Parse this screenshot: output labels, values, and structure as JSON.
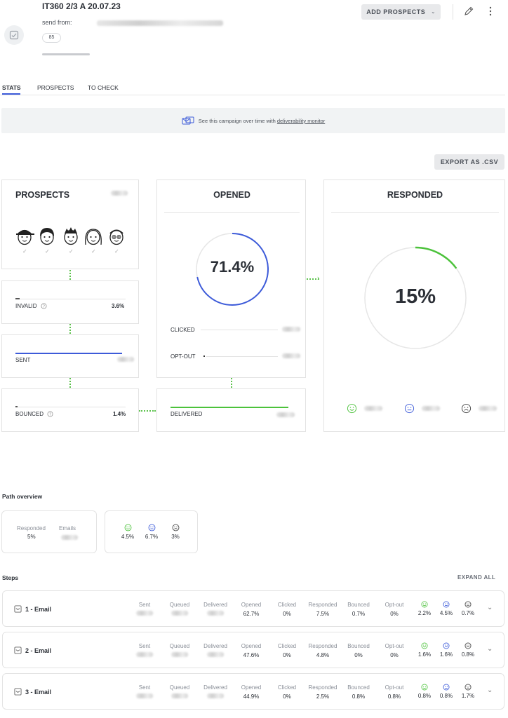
{
  "campaign": {
    "title": "IT360 2/3 A 20.07.23",
    "send_from_label": "send from:",
    "badge": "85"
  },
  "toolbar": {
    "add_prospects": "ADD PROSPECTS"
  },
  "tabs": [
    {
      "label": "STATS",
      "active": true
    },
    {
      "label": "PROSPECTS"
    },
    {
      "label": "TO CHECK"
    }
  ],
  "banner": {
    "text": "See this campaign over time with ",
    "link": "deliverability monitor"
  },
  "export_label": "EXPORT AS .CSV",
  "funnel": {
    "prospects_title": "PROSPECTS",
    "invalid": {
      "label": "INVALID",
      "value": "3.6%"
    },
    "sent": {
      "label": "SENT"
    },
    "bounced": {
      "label": "BOUNCED",
      "value": "1.4%"
    },
    "opened": {
      "title": "OPENED",
      "value": "71.4%",
      "percent": 71.4
    },
    "clicked_label": "CLICKED",
    "optout_label": "OPT-OUT",
    "delivered_label": "DELIVERED",
    "responded": {
      "title": "RESPONDED",
      "value": "15%",
      "percent": 15
    }
  },
  "colors": {
    "accent_blue": "#3d5bd9",
    "accent_green": "#4cc23b",
    "border": "#e3e3e3"
  },
  "path_overview": {
    "title": "Path overview",
    "responded_label": "Responded",
    "responded_value": "5%",
    "emails_label": "Emails",
    "positive": "4.5%",
    "neutral": "6.7%",
    "negative": "3%"
  },
  "steps_title": "Steps",
  "expand_all": "EXPAND ALL",
  "step_headers": [
    "Sent",
    "Queued",
    "Delivered",
    "Opened",
    "Clicked",
    "Responded",
    "Bounced",
    "Opt-out"
  ],
  "steps": [
    {
      "name": "1 - Email",
      "opened": "62.7%",
      "clicked": "0%",
      "responded": "7.5%",
      "bounced": "0.7%",
      "optout": "0%",
      "positive": "2.2%",
      "neutral": "4.5%",
      "negative": "0.7%"
    },
    {
      "name": "2 - Email",
      "opened": "47.6%",
      "clicked": "0%",
      "responded": "4.8%",
      "bounced": "0%",
      "optout": "0%",
      "positive": "1.6%",
      "neutral": "1.6%",
      "negative": "0.8%"
    },
    {
      "name": "3 - Email",
      "opened": "44.9%",
      "clicked": "0%",
      "responded": "2.5%",
      "bounced": "0.8%",
      "optout": "0.8%",
      "positive": "0.8%",
      "neutral": "0.8%",
      "negative": "1.7%"
    }
  ]
}
